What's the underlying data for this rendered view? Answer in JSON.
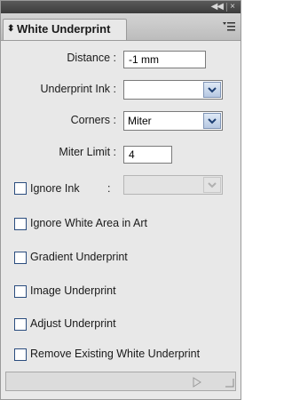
{
  "window": {
    "collapse_glyph": "◀◀",
    "close_glyph": "×"
  },
  "tab": {
    "title": "White Underprint",
    "arrows_glyph": "⬍",
    "menu_icon": "panel-menu-icon"
  },
  "fields": {
    "distance_label": "Distance :",
    "distance_value": "-1 mm",
    "underprint_ink_label": "Underprint Ink :",
    "underprint_ink_value": "",
    "corners_label": "Corners :",
    "corners_value": "Miter",
    "miter_limit_label": "Miter Limit :",
    "miter_limit_value": "4",
    "ignore_ink_label": "Ignore Ink",
    "ignore_ink_colon": ":",
    "ignore_ink_value": ""
  },
  "options": {
    "ignore_white_area": "Ignore White Area in Art",
    "gradient_underprint": "Gradient Underprint",
    "image_underprint": "Image Underprint",
    "adjust_underprint": "Adjust Underprint",
    "remove_existing": "Remove Existing White Underprint"
  },
  "colors": {
    "panel_bg": "#e8e8e8",
    "dropdown_accent": "#b6c8e2"
  }
}
